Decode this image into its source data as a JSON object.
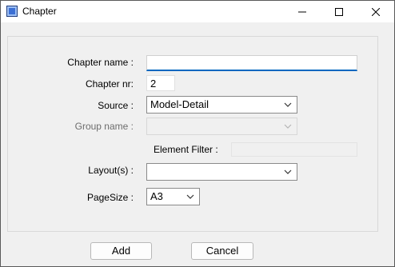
{
  "window": {
    "title": "Chapter",
    "controls": {
      "minimize": "minimize-icon",
      "maximize": "maximize-icon",
      "close": "close-icon"
    }
  },
  "form": {
    "chapter_name_label": "Chapter name :",
    "chapter_name_value": "",
    "chapter_nr_label": "Chapter nr:",
    "chapter_nr_value": "2",
    "source_label": "Source :",
    "source_value": "Model-Detail",
    "group_name_label": "Group name :",
    "group_name_value": "",
    "element_filter_label": "Element Filter :",
    "element_filter_value": "",
    "layouts_label": "Layout(s) :",
    "layouts_value": "",
    "pagesize_label": "PageSize :",
    "pagesize_value": "A3"
  },
  "buttons": {
    "add": "Add",
    "cancel": "Cancel"
  },
  "colors": {
    "accent": "#0067c0",
    "background": "#f0f0f0"
  }
}
